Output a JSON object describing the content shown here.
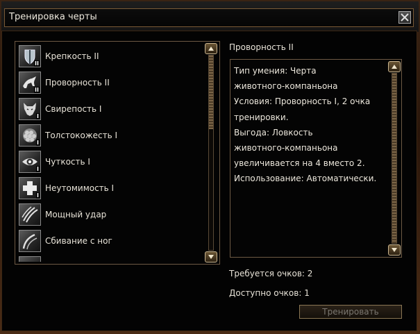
{
  "window": {
    "title": "Тренировка черты"
  },
  "feats": [
    {
      "label": "Крепкость II",
      "icon": "shield-icon",
      "rank": "II"
    },
    {
      "label": "Проворность II",
      "icon": "leaping-beast-icon",
      "rank": "II"
    },
    {
      "label": "Свирепость I",
      "icon": "wolf-head-icon",
      "rank": "I"
    },
    {
      "label": "Толстокожесть I",
      "icon": "scales-hide-icon",
      "rank": "I"
    },
    {
      "label": "Чуткость I",
      "icon": "eye-icon",
      "rank": "I"
    },
    {
      "label": "Неутомимость I",
      "icon": "cross-icon",
      "rank": "I"
    },
    {
      "label": "Мощный удар",
      "icon": "claw-marks-icon",
      "rank": ""
    },
    {
      "label": "Сбивание с ног",
      "icon": "claw-swipe-icon",
      "rank": ""
    }
  ],
  "detail": {
    "title": "Проворность II",
    "lines": [
      "Тип умения: Черта",
      "животного-компаньона",
      "Условия: Проворность I, 2 очка",
      "тренировки.",
      "Выгода: Ловкость",
      "животного-компаньона",
      "увеличивается на 4 вместо 2.",
      "Использование: Автоматически."
    ]
  },
  "points": {
    "required": "Требуется очков: 2",
    "available": "Доступно очков: 1"
  },
  "buttons": {
    "train": "Тренировать"
  },
  "colors": {
    "frame": "#3a2414",
    "panel": "#030303",
    "border": "#6e5a44",
    "text": "#e8e3d8",
    "disabled_text": "#7b7770"
  }
}
